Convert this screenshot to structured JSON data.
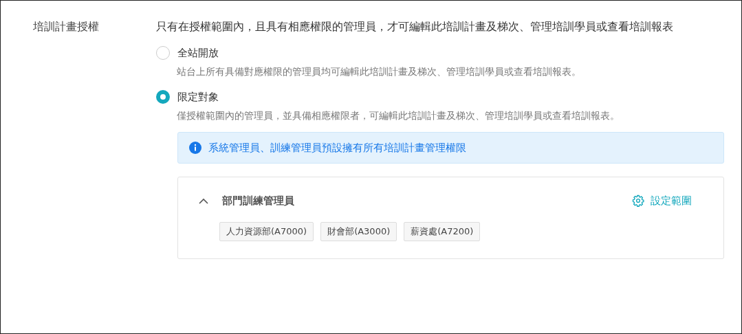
{
  "field": {
    "label": "培訓計畫授權",
    "description": "只有在授權範圍內，且具有相應權限的管理員，才可編輯此培訓計畫及梯次、管理培訓學員或查看培訓報表"
  },
  "options": [
    {
      "label": "全站開放",
      "description": "站台上所有具備對應權限的管理員均可編輯此培訓計畫及梯次、管理培訓學員或查看培訓報表。",
      "selected": false
    },
    {
      "label": "限定對象",
      "description": "僅授權範圍內的管理員，並具備相應權限者，可編輯此培訓計畫及梯次、管理培訓學員或查看培訓報表。",
      "selected": true
    }
  ],
  "notice": {
    "text": "系統管理員、訓練管理員預設擁有所有培訓計畫管理權限"
  },
  "groups": [
    {
      "title": "部門訓練管理員",
      "expanded": true,
      "action": "設定範圍",
      "tags": [
        "人力資源部(A7000)",
        "財會部(A3000)",
        "薪資處(A7200)"
      ]
    }
  ]
}
